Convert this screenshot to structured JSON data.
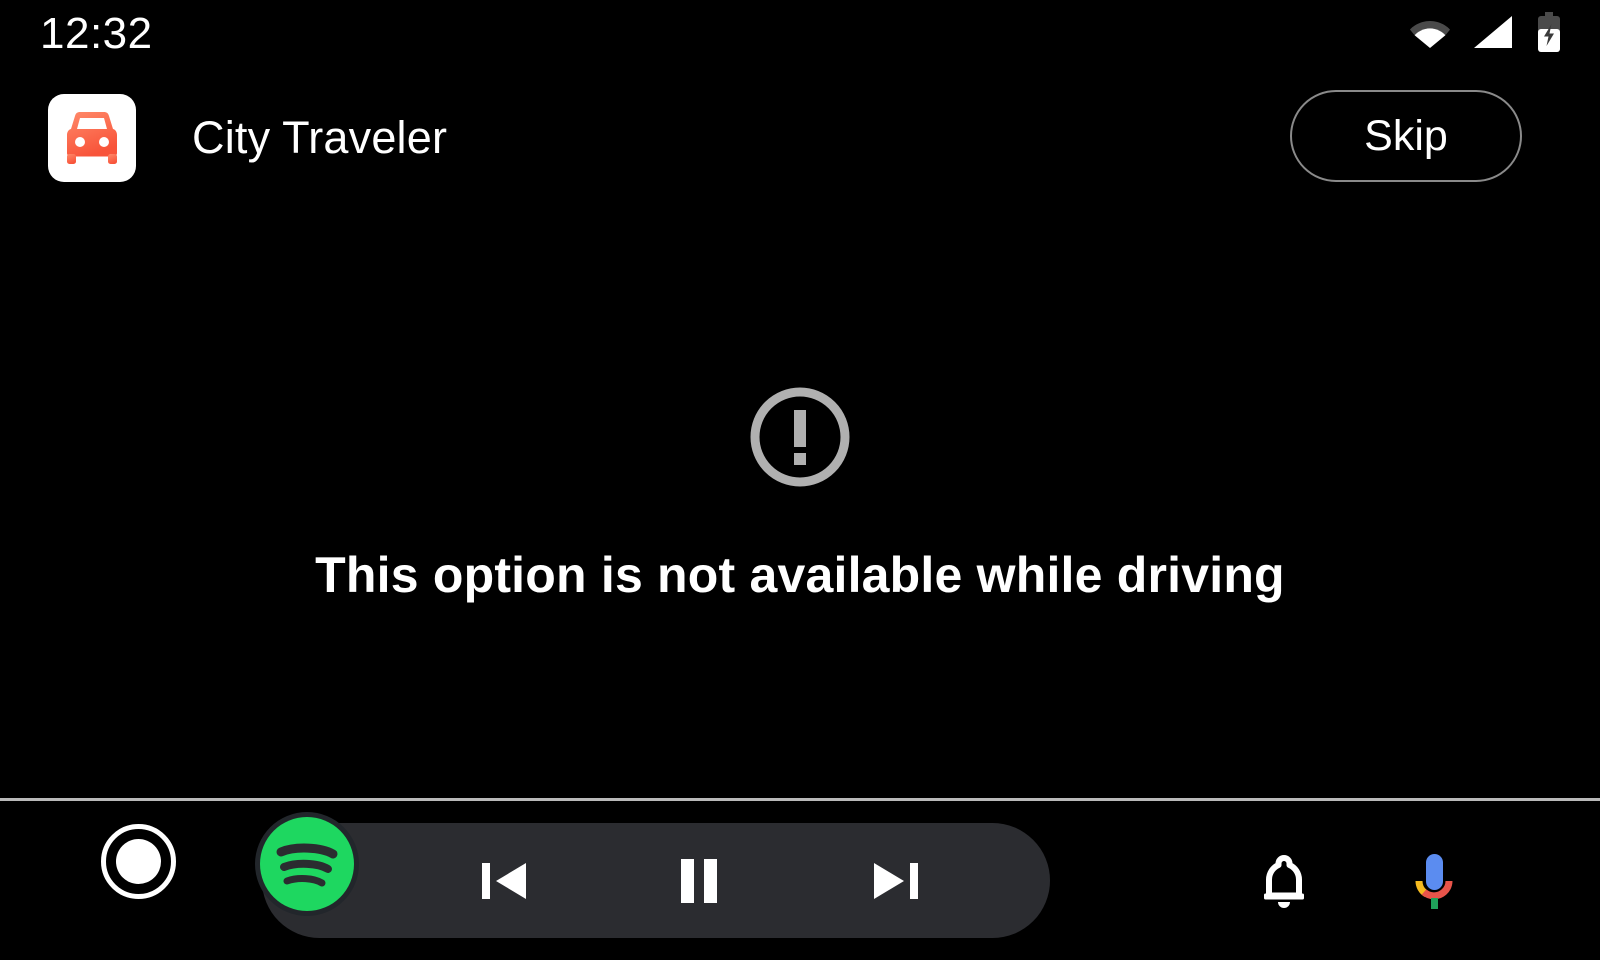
{
  "status_bar": {
    "clock": "12:32",
    "icons": [
      {
        "name": "wifi-icon",
        "label": "Wi-Fi"
      },
      {
        "name": "cellular-signal-icon",
        "label": "Cellular signal"
      },
      {
        "name": "battery-charging-icon",
        "label": "Battery charging"
      }
    ]
  },
  "app_header": {
    "app_icon_name": "car-app-icon",
    "title": "City Traveler",
    "skip_label": "Skip"
  },
  "content": {
    "warning_icon_name": "error-exclamation-circle-icon",
    "message": "This option is not available while driving"
  },
  "nav_bar": {
    "home_label": "Home",
    "media_app": "Spotify",
    "previous_label": "Previous track",
    "play_pause_label": "Pause",
    "next_label": "Next track",
    "notifications_label": "Notifications",
    "assistant_label": "Google Assistant"
  },
  "colors": {
    "background": "#000000",
    "text_primary": "#ffffff",
    "warning_gray": "#b0b0b0",
    "divider": "#b9b9b9",
    "media_pill": "#2b2c30",
    "spotify_green": "#1ed760",
    "app_icon_bg": "#ffffff",
    "app_icon_car": "#fa6a4f",
    "assistant_blue": "#5b8cf0",
    "assistant_red": "#e8544a",
    "assistant_yellow": "#f5bb20",
    "assistant_green": "#1fa25a",
    "skip_border": "#8a8a8a"
  }
}
